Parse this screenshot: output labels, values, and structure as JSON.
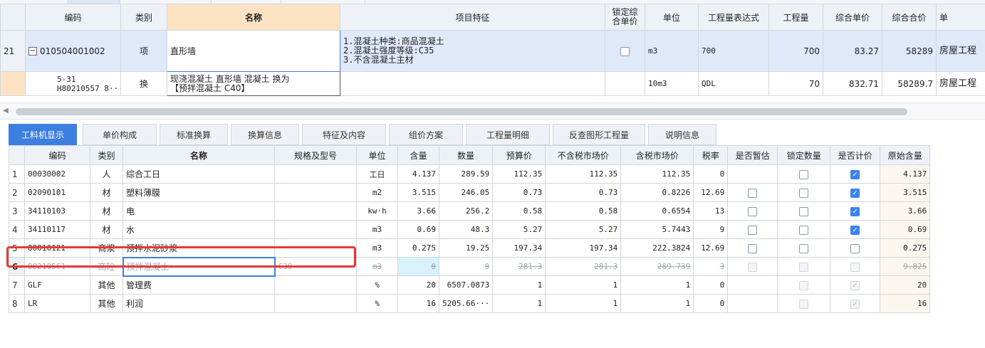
{
  "upper": {
    "headers": [
      "编码",
      "类别",
      "名称",
      "项目特征",
      "锁定综合单价",
      "单位",
      "工程量表达式",
      "工程量",
      "综合单价",
      "综合合价",
      "单"
    ],
    "rows": [
      {
        "rownum": "21",
        "tree": "−",
        "code": "010504001002",
        "type": "项",
        "name": "直形墙",
        "feature_lines": [
          "1.混凝土种类:商品混凝土",
          "2.混凝土强度等级:C35",
          "3.不含混凝土主材"
        ],
        "locked": false,
        "unit": "m3",
        "expr": "700",
        "qty": "700",
        "unit_price": "83.27",
        "total": "58289",
        "extra": "房屋工程"
      },
      {
        "rownum": "",
        "code_line1": "5-31",
        "code_line2": "H80210557 8···",
        "type": "换",
        "name_line1": "现浇混凝土 直形墙 混凝土  换为",
        "name_line2": "【预拌混凝土 C40】",
        "unit": "10m3",
        "expr": "QDL",
        "qty": "70",
        "unit_price": "832.71",
        "total": "58289.7",
        "extra": "房屋工程"
      }
    ]
  },
  "scroll": {
    "left_arrow": "◀"
  },
  "tabs": [
    "工料机显示",
    "单价构成",
    "标准换算",
    "换算信息",
    "特征及内容",
    "组价方案",
    "工程量明细",
    "反查图形工程量",
    "说明信息"
  ],
  "lower": {
    "headers": [
      "",
      "编码",
      "类别",
      "名称",
      "规格及型号",
      "单位",
      "含量",
      "数量",
      "预算价",
      "不含税市场价",
      "含税市场价",
      "税率",
      "是否暂估",
      "锁定数量",
      "是否计价",
      "原始含量"
    ],
    "rows": [
      {
        "n": "1",
        "code": "00030002",
        "type": "人",
        "name": "综合工日",
        "spec": "",
        "unit": "工日",
        "content": "4.137",
        "qty": "289.59",
        "budget": "112.35",
        "mkt_ex": "112.35",
        "mkt_in": "112.35",
        "tax": "0",
        "est": "none",
        "lockq": "off",
        "priced": "on",
        "orig": "4.137"
      },
      {
        "n": "2",
        "code": "02090101",
        "type": "材",
        "name": "塑料薄膜",
        "spec": "",
        "unit": "m2",
        "content": "3.515",
        "qty": "246.05",
        "budget": "0.73",
        "mkt_ex": "0.73",
        "mkt_in": "0.8226",
        "tax": "12.69",
        "est": "off",
        "lockq": "off",
        "priced": "on",
        "orig": "3.515"
      },
      {
        "n": "3",
        "code": "34110103",
        "type": "材",
        "name": "电",
        "spec": "",
        "unit": "kw·h",
        "content": "3.66",
        "qty": "256.2",
        "budget": "0.58",
        "mkt_ex": "0.58",
        "mkt_in": "0.6554",
        "tax": "13",
        "est": "off",
        "lockq": "off",
        "priced": "on",
        "orig": "3.66"
      },
      {
        "n": "4",
        "code": "34110117",
        "type": "材",
        "name": "水",
        "spec": "",
        "unit": "m3",
        "content": "0.69",
        "qty": "48.3",
        "budget": "5.27",
        "mkt_ex": "5.27",
        "mkt_in": "5.7443",
        "tax": "9",
        "est": "off",
        "lockq": "off",
        "priced": "on",
        "orig": "0.69"
      },
      {
        "n": "5",
        "code": "80010121",
        "type": "商浆",
        "name": "预拌水泥砂浆",
        "spec": "",
        "unit": "m3",
        "content": "0.275",
        "qty": "19.25",
        "budget": "197.34",
        "mkt_ex": "197.34",
        "mkt_in": "222.3824",
        "tax": "12.69",
        "est": "off",
        "lockq": "off",
        "priced": "off",
        "orig": "0.275"
      },
      {
        "n": "6",
        "code": "80210561",
        "type": "商砼",
        "name": "预拌混凝土",
        "spec": "C30",
        "unit": "m3",
        "content": "0",
        "qty": "0",
        "budget": "281.3",
        "mkt_ex": "281.3",
        "mkt_in": "289.739",
        "tax": "3",
        "est": "dis",
        "lockq": "dis",
        "priced": "dis",
        "orig": "9.825"
      },
      {
        "n": "7",
        "code": "GLF",
        "type": "其他",
        "name": "管理费",
        "spec": "",
        "unit": "%",
        "content": "20",
        "qty": "6507.0873",
        "budget": "1",
        "mkt_ex": "1",
        "mkt_in": "1",
        "tax": "0",
        "est": "none",
        "lockq": "dis",
        "priced": "dis-on",
        "orig": "20"
      },
      {
        "n": "8",
        "code": "LR",
        "type": "其他",
        "name": "利润",
        "spec": "",
        "unit": "%",
        "content": "16",
        "qty": "5205.66···",
        "budget": "1",
        "mkt_ex": "1",
        "mkt_in": "1",
        "tax": "0",
        "est": "none",
        "lockq": "dis",
        "priced": "dis-on",
        "orig": "16"
      }
    ]
  },
  "colors": {
    "accent": "#3d7fe0",
    "highlight_row": "#dfe9f9",
    "name_header": "#fde3c3",
    "red_box": "#e53935"
  }
}
